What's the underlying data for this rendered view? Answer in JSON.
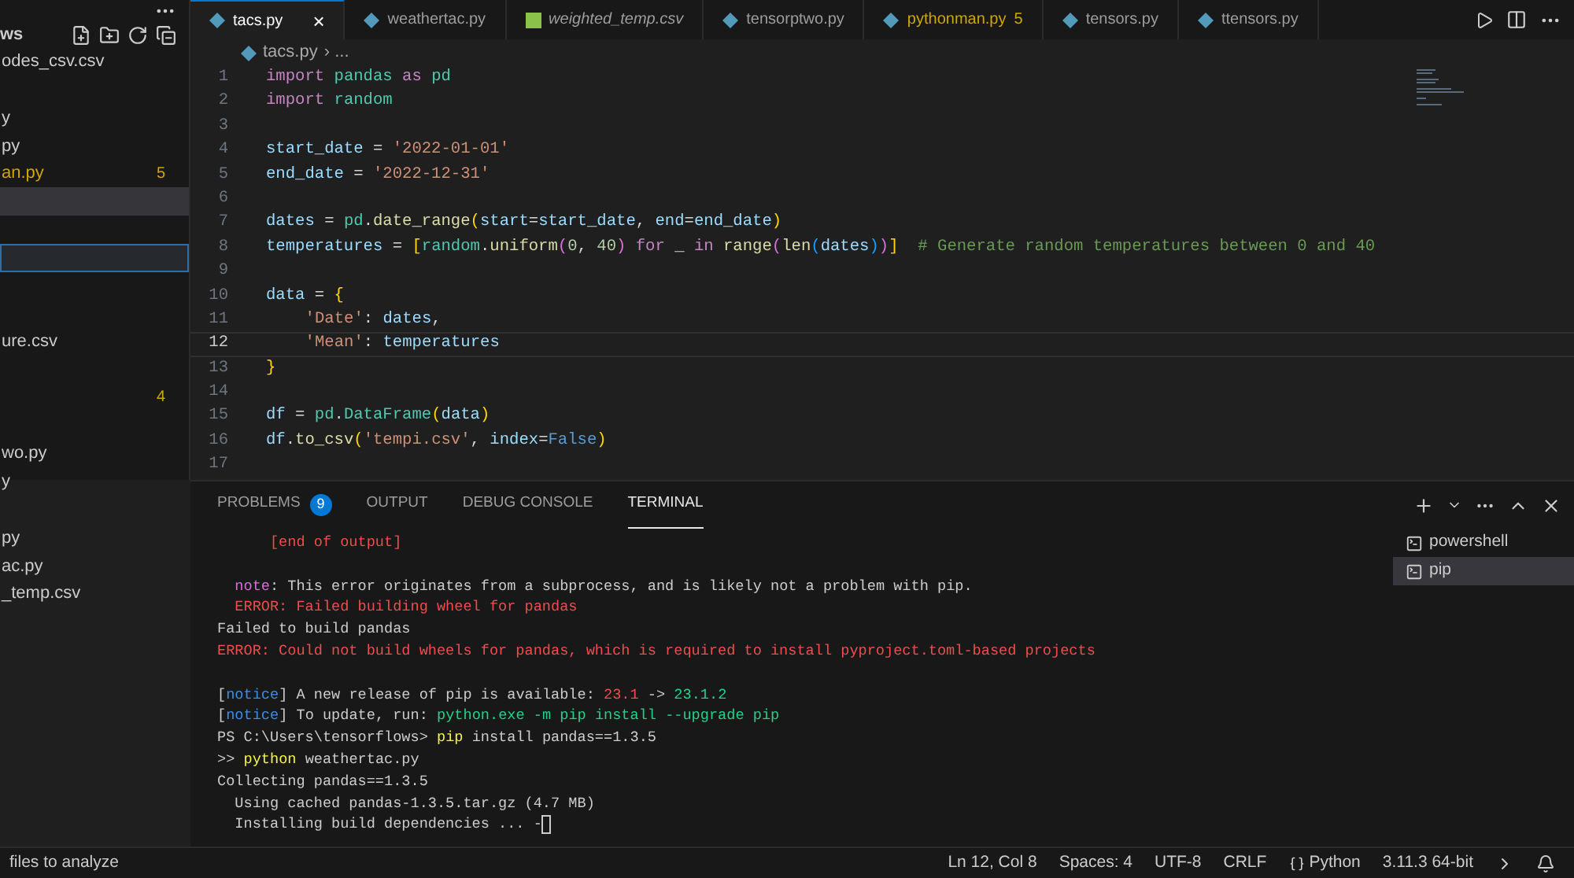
{
  "sidebar": {
    "title": "ws",
    "items": [
      {
        "label": "odes_csv.csv",
        "selected": false,
        "hovered": false
      },
      {
        "selected": false,
        "hovered": false
      },
      {
        "label": "y",
        "selected": false,
        "hovered": false
      },
      {
        "label": "py",
        "selected": false,
        "hovered": false
      },
      {
        "label": "an.py",
        "warning": true,
        "badge": "5",
        "selected": false,
        "hovered": false
      },
      {
        "selected": false,
        "hovered": true
      },
      {
        "selected": false,
        "hovered": false
      },
      {
        "selected": true,
        "hovered": false
      },
      {
        "selected": false,
        "hovered": false
      },
      {
        "selected": false,
        "hovered": false
      },
      {
        "label": "ure.csv",
        "selected": false,
        "hovered": false
      },
      {
        "selected": false,
        "hovered": false
      },
      {
        "badge": "4",
        "selected": false,
        "hovered": false
      },
      {
        "selected": false,
        "hovered": false
      },
      {
        "label": "wo.py",
        "selected": false,
        "hovered": false
      },
      {
        "label": "y",
        "selected": false,
        "hovered": false
      },
      {
        "selected": false,
        "hovered": false
      },
      {
        "label": "py",
        "selected": false,
        "hovered": false
      },
      {
        "label": "ac.py",
        "selected": false,
        "hovered": false
      },
      {
        "label": "_temp.csv",
        "selected": false,
        "hovered": false
      }
    ]
  },
  "tabs": [
    {
      "label": "tacs.py",
      "kind": "py",
      "selected": true,
      "preview": false,
      "warning": false,
      "close": "×"
    },
    {
      "label": "weathertac.py",
      "kind": "py",
      "selected": false,
      "preview": false,
      "warning": false
    },
    {
      "label": "weighted_temp.csv",
      "kind": "csv",
      "selected": false,
      "preview": true,
      "warning": false
    },
    {
      "label": "tensorptwo.py",
      "kind": "py",
      "selected": false,
      "preview": false,
      "warning": false
    },
    {
      "label": "pythonman.py",
      "kind": "py",
      "selected": false,
      "preview": false,
      "warning": true,
      "badge": "5"
    },
    {
      "label": "tensors.py",
      "kind": "py",
      "selected": false,
      "preview": false,
      "warning": false
    },
    {
      "label": "ttensors.py",
      "kind": "py",
      "selected": false,
      "preview": false,
      "warning": false
    }
  ],
  "breadcrumb": {
    "file": "tacs.py",
    "rest": "› ..."
  },
  "code": [
    {
      "number": "1",
      "current": false,
      "tokens": [
        {
          "kind": "kw",
          "text": "import "
        },
        {
          "kind": "mod",
          "text": "pandas "
        },
        {
          "kind": "kw",
          "text": "as "
        },
        {
          "kind": "mod",
          "text": "pd"
        }
      ]
    },
    {
      "number": "2",
      "current": false,
      "tokens": [
        {
          "kind": "kw",
          "text": "import "
        },
        {
          "kind": "mod",
          "text": "random"
        }
      ]
    },
    {
      "number": "3",
      "current": false
    },
    {
      "number": "4",
      "current": false,
      "tokens": [
        {
          "kind": "var",
          "text": "start_date"
        },
        {
          "kind": "plain",
          "text": " = "
        },
        {
          "kind": "str",
          "text": "'2022-01-01'"
        }
      ]
    },
    {
      "number": "5",
      "current": false,
      "tokens": [
        {
          "kind": "var",
          "text": "end_date"
        },
        {
          "kind": "plain",
          "text": " = "
        },
        {
          "kind": "str",
          "text": "'2022-12-31'"
        }
      ]
    },
    {
      "number": "6",
      "current": false
    },
    {
      "number": "7",
      "current": false,
      "tokens": [
        {
          "kind": "var",
          "text": "dates"
        },
        {
          "kind": "plain",
          "text": " = "
        },
        {
          "kind": "mod",
          "text": "pd"
        },
        {
          "kind": "plain",
          "text": "."
        },
        {
          "kind": "fn",
          "text": "date_range"
        },
        {
          "kind": "br",
          "text": "("
        },
        {
          "kind": "var",
          "text": "start"
        },
        {
          "kind": "plain",
          "text": "="
        },
        {
          "kind": "var",
          "text": "start_date"
        },
        {
          "kind": "plain",
          "text": ", "
        },
        {
          "kind": "var",
          "text": "end"
        },
        {
          "kind": "plain",
          "text": "="
        },
        {
          "kind": "var",
          "text": "end_date"
        },
        {
          "kind": "br",
          "text": ")"
        }
      ]
    },
    {
      "number": "8",
      "current": false,
      "tokens": [
        {
          "kind": "var",
          "text": "temperatures"
        },
        {
          "kind": "plain",
          "text": " = "
        },
        {
          "kind": "br",
          "text": "["
        },
        {
          "kind": "mod",
          "text": "random"
        },
        {
          "kind": "plain",
          "text": "."
        },
        {
          "kind": "fn",
          "text": "uniform"
        },
        {
          "kind": "br2",
          "text": "("
        },
        {
          "kind": "num",
          "text": "0"
        },
        {
          "kind": "plain",
          "text": ", "
        },
        {
          "kind": "num",
          "text": "40"
        },
        {
          "kind": "br2",
          "text": ") "
        },
        {
          "kind": "kw",
          "text": "for "
        },
        {
          "kind": "var",
          "text": "_ "
        },
        {
          "kind": "kw",
          "text": "in "
        },
        {
          "kind": "fn",
          "text": "range"
        },
        {
          "kind": "br2",
          "text": "("
        },
        {
          "kind": "fn",
          "text": "len"
        },
        {
          "kind": "br3",
          "text": "("
        },
        {
          "kind": "var",
          "text": "dates"
        },
        {
          "kind": "br3",
          "text": ")"
        },
        {
          "kind": "br2",
          "text": ")"
        },
        {
          "kind": "br",
          "text": "]  "
        },
        {
          "kind": "comment",
          "text": "# Generate random temperatures between 0 and 40"
        }
      ]
    },
    {
      "number": "9",
      "current": false
    },
    {
      "number": "10",
      "current": false,
      "tokens": [
        {
          "kind": "var",
          "text": "data"
        },
        {
          "kind": "plain",
          "text": " = "
        },
        {
          "kind": "br",
          "text": "{"
        }
      ]
    },
    {
      "number": "11",
      "current": false,
      "indent": true,
      "tokens": [
        {
          "kind": "str",
          "text": "'Date'"
        },
        {
          "kind": "plain",
          "text": ": "
        },
        {
          "kind": "var",
          "text": "dates"
        },
        {
          "kind": "plain",
          "text": ","
        }
      ]
    },
    {
      "number": "12",
      "current": true,
      "indent": true,
      "tokens": [
        {
          "kind": "str",
          "text": "'Mean'"
        },
        {
          "kind": "plain",
          "text": ": "
        },
        {
          "kind": "var",
          "text": "temperatures"
        }
      ]
    },
    {
      "number": "13",
      "current": false,
      "tokens": [
        {
          "kind": "br",
          "text": "}"
        }
      ]
    },
    {
      "number": "14",
      "current": false
    },
    {
      "number": "15",
      "current": false,
      "tokens": [
        {
          "kind": "var",
          "text": "df"
        },
        {
          "kind": "plain",
          "text": " = "
        },
        {
          "kind": "mod",
          "text": "pd"
        },
        {
          "kind": "plain",
          "text": "."
        },
        {
          "kind": "mod",
          "text": "DataFrame"
        },
        {
          "kind": "br",
          "text": "("
        },
        {
          "kind": "var",
          "text": "data"
        },
        {
          "kind": "br",
          "text": ")"
        }
      ]
    },
    {
      "number": "16",
      "current": false,
      "tokens": [
        {
          "kind": "var",
          "text": "df"
        },
        {
          "kind": "plain",
          "text": "."
        },
        {
          "kind": "fn",
          "text": "to_csv"
        },
        {
          "kind": "br",
          "text": "("
        },
        {
          "kind": "str",
          "text": "'tempi.csv'"
        },
        {
          "kind": "plain",
          "text": ", "
        },
        {
          "kind": "var",
          "text": "index"
        },
        {
          "kind": "plain",
          "text": "="
        },
        {
          "kind": "const",
          "text": "False"
        },
        {
          "kind": "br",
          "text": ")"
        }
      ]
    },
    {
      "number": "17",
      "current": false
    }
  ],
  "panel": {
    "tabs": [
      {
        "label": "PROBLEMS",
        "badge": "9",
        "selected": false
      },
      {
        "label": "OUTPUT",
        "selected": false
      },
      {
        "label": "DEBUG CONSOLE",
        "selected": false
      },
      {
        "label": "TERMINAL",
        "selected": true
      }
    ],
    "terminal": [
      {
        "tokens": [
          {
            "kind": "red",
            "text": "      [end of output]"
          }
        ]
      },
      {
        "blank_before": true,
        "tokens": [
          {
            "kind": "magenta",
            "text": "  note"
          },
          {
            "kind": "plain",
            "text": ": This error originates from a subprocess, and is likely not a problem with pip."
          }
        ]
      },
      {
        "tokens": [
          {
            "kind": "red",
            "text": "  ERROR: Failed building wheel for pandas"
          }
        ]
      },
      {
        "tokens": [
          {
            "kind": "plain",
            "text": "Failed to build pandas"
          }
        ]
      },
      {
        "tokens": [
          {
            "kind": "red",
            "text": "ERROR: Could not build wheels for pandas, which is required to install pyproject.toml-based projects"
          }
        ]
      },
      {
        "blank_before": true,
        "tokens": [
          {
            "kind": "plain",
            "text": "["
          },
          {
            "kind": "blue",
            "text": "notice"
          },
          {
            "kind": "plain",
            "text": "] A new release of pip is available: "
          },
          {
            "kind": "red",
            "text": "23.1"
          },
          {
            "kind": "plain",
            "text": " -> "
          },
          {
            "kind": "green",
            "text": "23.1.2"
          }
        ]
      },
      {
        "tokens": [
          {
            "kind": "plain",
            "text": "["
          },
          {
            "kind": "blue",
            "text": "notice"
          },
          {
            "kind": "plain",
            "text": "] To update, run: "
          },
          {
            "kind": "green",
            "text": "python.exe -m pip install --upgrade pip"
          }
        ]
      },
      {
        "tokens": [
          {
            "kind": "plain",
            "text": "PS C:\\Users\\tensorflows> "
          },
          {
            "kind": "yellow",
            "text": "pip"
          },
          {
            "kind": "plain",
            "text": " install pandas==1.3.5"
          }
        ]
      },
      {
        "tokens": [
          {
            "kind": "plain",
            "text": ">> "
          },
          {
            "kind": "yellow",
            "text": "python"
          },
          {
            "kind": "plain",
            "text": " weathertac.py"
          }
        ]
      },
      {
        "tokens": [
          {
            "kind": "plain",
            "text": "Collecting pandas==1.3.5"
          }
        ]
      },
      {
        "tokens": [
          {
            "kind": "plain",
            "text": "  Using cached pandas-1.3.5.tar.gz (4.7 MB)"
          }
        ]
      },
      {
        "cursor": true,
        "tokens": [
          {
            "kind": "plain",
            "text": "  Installing build dependencies ... -"
          }
        ]
      }
    ],
    "sessions": [
      {
        "label": "powershell",
        "selected": false
      },
      {
        "label": "pip",
        "selected": true
      }
    ]
  },
  "status_bar": {
    "left": "files to analyze",
    "items": [
      "Ln 12, Col 8",
      "Spaces: 4",
      "UTF-8",
      "CRLF"
    ],
    "language": "Python",
    "interpreter": "3.11.3 64-bit"
  }
}
